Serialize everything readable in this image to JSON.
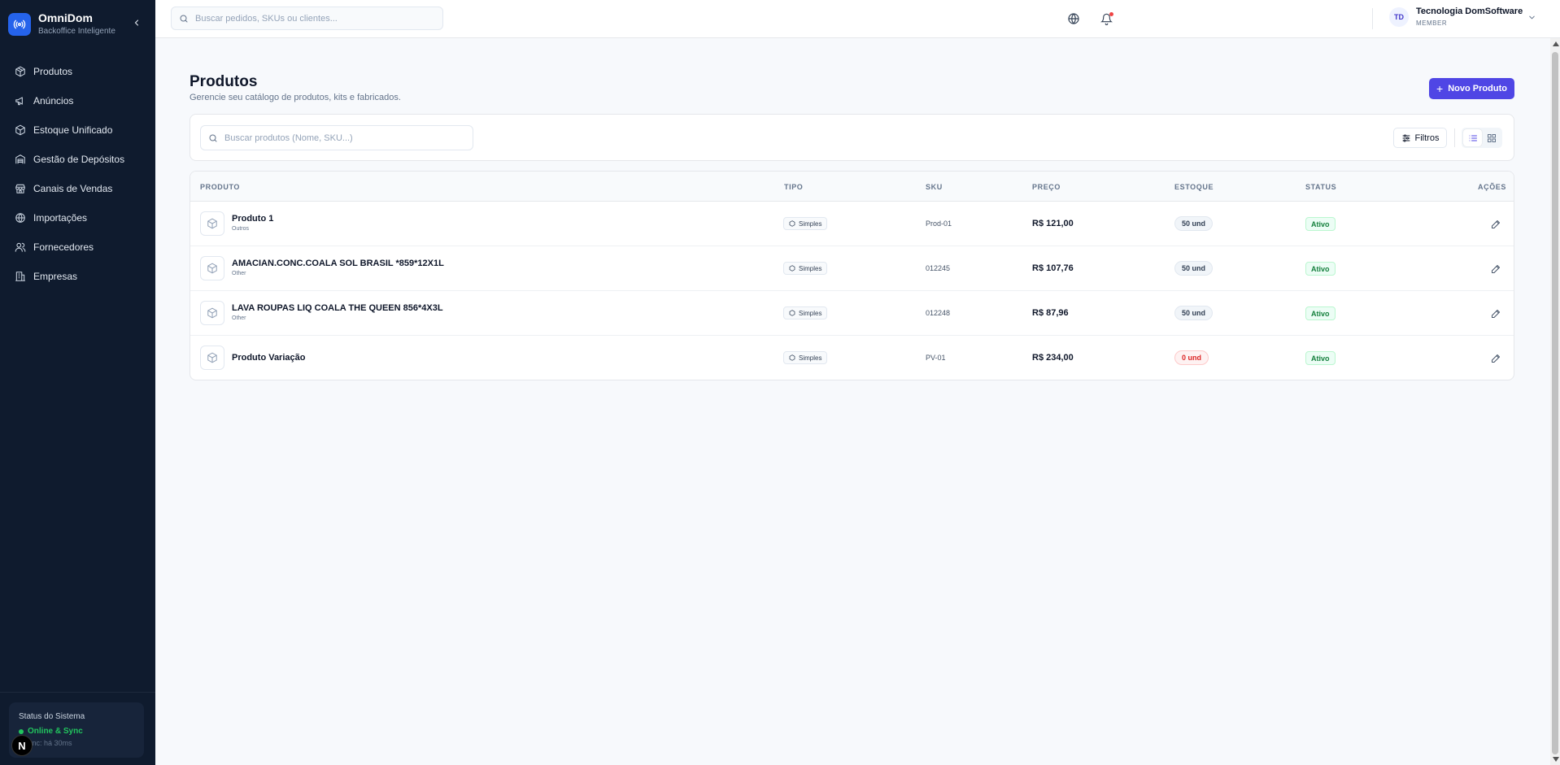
{
  "brand": {
    "name": "OmniDom",
    "subtitle": "Backoffice Inteligente"
  },
  "nav": [
    {
      "label": "Produtos",
      "icon": "package-icon"
    },
    {
      "label": "Anúncios",
      "icon": "megaphone-icon"
    },
    {
      "label": "Estoque Unificado",
      "icon": "box-icon"
    },
    {
      "label": "Gestão de Depósitos",
      "icon": "warehouse-icon"
    },
    {
      "label": "Canais de Vendas",
      "icon": "store-icon"
    },
    {
      "label": "Importações",
      "icon": "globe-icon"
    },
    {
      "label": "Fornecedores",
      "icon": "users-icon"
    },
    {
      "label": "Empresas",
      "icon": "building-icon"
    }
  ],
  "system_status": {
    "title": "Status do Sistema",
    "state": "Online & Sync",
    "last_sync": "a sync: há 30ms"
  },
  "dev_badge": "N",
  "topbar": {
    "search_placeholder": "Buscar pedidos, SKUs ou clientes...",
    "user": {
      "initials": "TD",
      "name": "Tecnologia DomSoftware",
      "role": "MEMBER"
    }
  },
  "page": {
    "title": "Produtos",
    "subtitle": "Gerencie seu catálogo de produtos, kits e fabricados.",
    "new_button": "Novo Produto"
  },
  "filters": {
    "search_placeholder": "Buscar produtos (Nome, SKU...)",
    "filters_label": "Filtros"
  },
  "table": {
    "columns": {
      "product": "PRODUTO",
      "type": "TIPO",
      "sku": "SKU",
      "price": "PREÇO",
      "stock": "ESTOQUE",
      "status": "STATUS",
      "actions": "AÇÕES"
    },
    "rows": [
      {
        "name": "Produto 1",
        "category": "Outros",
        "type": "Simples",
        "sku": "Prod-01",
        "price": "R$ 121,00",
        "stock": "50 und",
        "status": "Ativo"
      },
      {
        "name": "AMACIAN.CONC.COALA SOL BRASIL *859*12X1L",
        "category": "Other",
        "type": "Simples",
        "sku": "012245",
        "price": "R$ 107,76",
        "stock": "50 und",
        "status": "Ativo"
      },
      {
        "name": "LAVA ROUPAS LIQ COALA THE QUEEN 856*4X3L",
        "category": "Other",
        "type": "Simples",
        "sku": "012248",
        "price": "R$ 87,96",
        "stock": "50 und",
        "status": "Ativo"
      },
      {
        "name": "Produto Variação",
        "category": "",
        "type": "Simples",
        "sku": "PV-01",
        "price": "R$ 234,00",
        "stock": "0 und",
        "status": "Ativo"
      }
    ]
  },
  "colors": {
    "sidebar": "#0f1b2e",
    "accent": "#4f46e5",
    "success": "#22c55e",
    "danger": "#dc2626"
  }
}
